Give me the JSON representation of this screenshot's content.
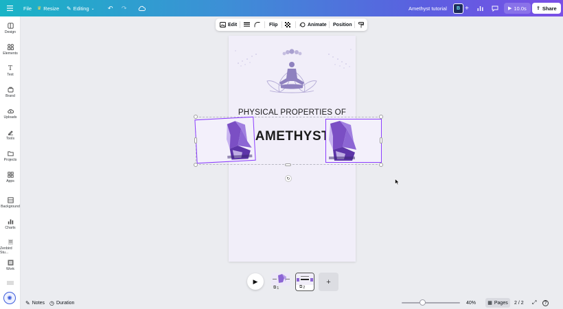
{
  "topbar": {
    "file_label": "File",
    "resize_label": "Resize",
    "editing_label": "Editing",
    "design_title": "Amethyst tutorial",
    "timer_label": "10.0s",
    "share_label": "Share",
    "avatar_text": "B"
  },
  "sidebar": {
    "items": [
      {
        "label": "Design",
        "icon": "design-icon"
      },
      {
        "label": "Elements",
        "icon": "elements-icon"
      },
      {
        "label": "Text",
        "icon": "text-icon"
      },
      {
        "label": "Brand",
        "icon": "brand-icon"
      },
      {
        "label": "Uploads",
        "icon": "uploads-icon"
      },
      {
        "label": "Tools",
        "icon": "tools-icon"
      },
      {
        "label": "Projects",
        "icon": "projects-icon"
      },
      {
        "label": "Apps",
        "icon": "apps-icon"
      },
      {
        "label": "Background",
        "icon": "background-icon"
      },
      {
        "label": "Charts",
        "icon": "charts-icon"
      },
      {
        "label": "Zenbird Stu...",
        "icon": "zenbird-icon"
      },
      {
        "label": "Work",
        "icon": "work-icon"
      }
    ]
  },
  "context_toolbar": {
    "edit_label": "Edit",
    "flip_label": "Flip",
    "animate_label": "Animate",
    "position_label": "Position"
  },
  "canvas": {
    "subtitle": "PHYSICAL PROPERTIES OF",
    "title": "AMETHYST"
  },
  "thumbnails": {
    "page1_number": "1",
    "page2_number": "2"
  },
  "footer": {
    "notes_label": "Notes",
    "duration_label": "Duration",
    "zoom_label": "40%",
    "pages_label": "Pages",
    "page_count": "2 / 2"
  },
  "colors": {
    "accent_purple": "#8b3dff",
    "page_bg": "#f1eef9",
    "silhouette": "#8f82bf"
  }
}
